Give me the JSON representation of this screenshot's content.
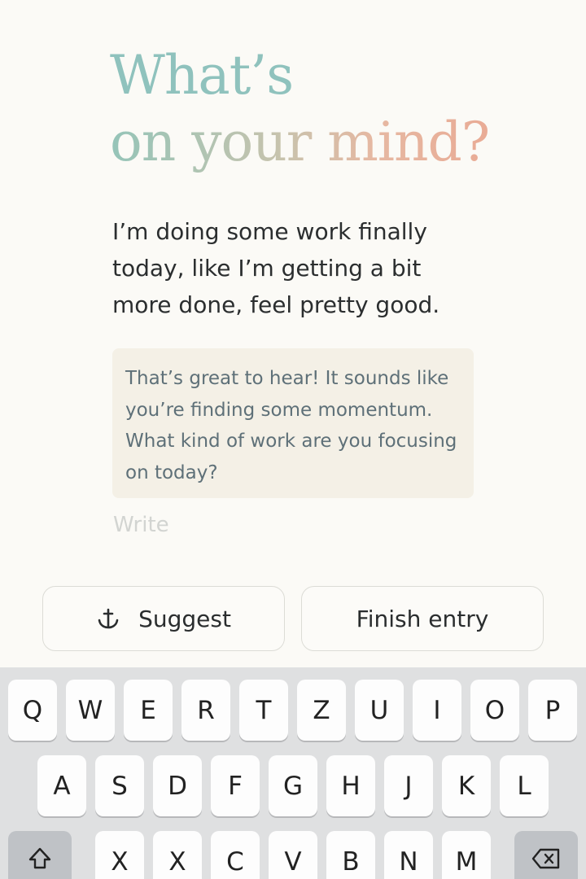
{
  "prompt": {
    "title_line1": "What’s",
    "title_line2": "on your mind?"
  },
  "entry": {
    "user_text": "I’m doing some work finally today, like I’m getting a bit more done, feel pretty good.",
    "ai_response": "That’s great to hear! It sounds like you’re finding some momentum. What kind of work are you focusing on today?",
    "write_placeholder": "Write"
  },
  "actions": {
    "suggest_label": "Suggest",
    "suggest_icon": "anchor-icon",
    "finish_label": "Finish entry"
  },
  "keyboard": {
    "row1": [
      "Q",
      "W",
      "E",
      "R",
      "T",
      "Z",
      "U",
      "I",
      "O",
      "P"
    ],
    "row2": [
      "A",
      "S",
      "D",
      "F",
      "G",
      "H",
      "J",
      "K",
      "L"
    ],
    "row3": [
      "X",
      "X",
      "C",
      "V",
      "B",
      "N",
      "M"
    ],
    "shift_icon": "shift-icon",
    "delete_icon": "delete-icon"
  },
  "colors": {
    "background": "#fbfaf6",
    "title_teal": "#8fc2bd",
    "title_peach": "#e9ab95",
    "ai_box": "#f4f0e6",
    "ai_text": "#5e7078"
  }
}
